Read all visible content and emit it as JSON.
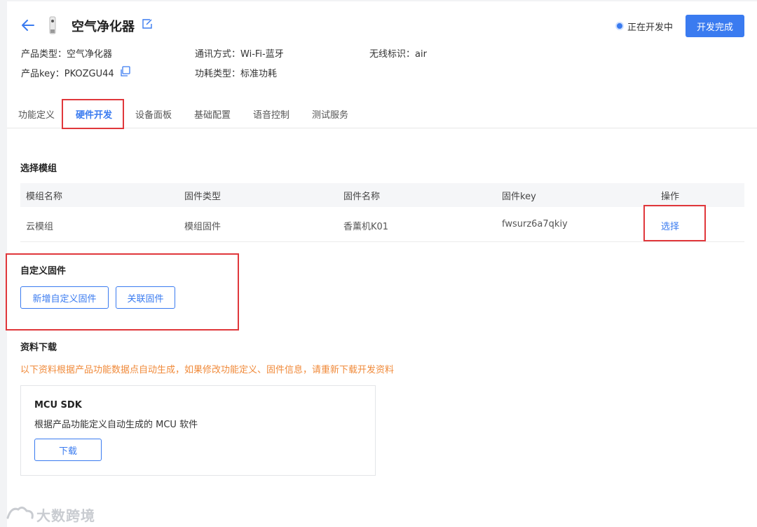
{
  "header": {
    "title": "空气净化器",
    "status_text": "正在开发中",
    "finish_button": "开发完成"
  },
  "meta": {
    "product_type_label": "产品类型：",
    "product_type_value": "空气净化器",
    "comm_label": "通讯方式：",
    "comm_value": "Wi-Fi-蓝牙",
    "wireless_label": "无线标识：",
    "wireless_value": "air",
    "key_label": "产品key：",
    "key_value": "PKOZGU44",
    "power_label": "功耗类型：",
    "power_value": "标准功耗"
  },
  "tabs": [
    {
      "label": "功能定义"
    },
    {
      "label": "硬件开发"
    },
    {
      "label": "设备面板"
    },
    {
      "label": "基础配置"
    },
    {
      "label": "语音控制"
    },
    {
      "label": "测试服务"
    }
  ],
  "module": {
    "title": "选择模组",
    "columns": [
      "模组名称",
      "固件类型",
      "固件名称",
      "固件key",
      "操作"
    ],
    "row": {
      "name": "云模组",
      "firmware_type": "模组固件",
      "firmware_name": "香薰机K01",
      "firmware_key": "fwsurz6a7qkiy",
      "action": "选择"
    }
  },
  "custom_firmware": {
    "title": "自定义固件",
    "add_button": "新增自定义固件",
    "link_button": "关联固件"
  },
  "download": {
    "title": "资料下载",
    "notice": "以下资料根据产品功能数据点自动生成，如果修改功能定义、固件信息，请重新下载开发资料",
    "card_title": "MCU SDK",
    "card_desc": "根据产品功能定义自动生成的 MCU 软件",
    "card_button": "下载"
  },
  "watermark": "大数跨境",
  "colors": {
    "accent": "#3a7bf0",
    "highlight": "#e0373b",
    "notice": "#f08a3a"
  }
}
